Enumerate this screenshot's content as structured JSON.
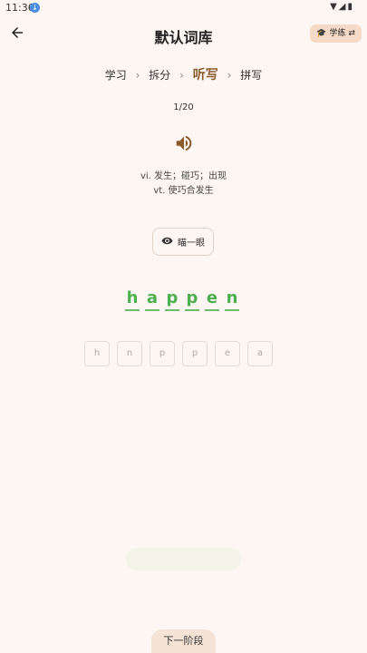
{
  "status": {
    "time": "11:36",
    "notification_badge": "◉",
    "icons": "▾◢▮"
  },
  "header": {
    "title": "默认词库",
    "mode_badge": "学练"
  },
  "steps": [
    {
      "label": "学习"
    },
    {
      "label": "拆分"
    },
    {
      "label": "听写",
      "active": true
    },
    {
      "label": "拼写"
    }
  ],
  "progress": "1/20",
  "definitions": [
    "vi. 发生；碰巧；出现",
    "vt. 使巧合发生"
  ],
  "peek_label": "瞄一眼",
  "answer_letters": [
    "h",
    "a",
    "p",
    "p",
    "e",
    "n"
  ],
  "letter_tiles": [
    "h",
    "n",
    "p",
    "p",
    "e",
    "a"
  ],
  "next_label": "下一阶段",
  "colors": {
    "accent": "#8a5a2b",
    "correct": "#4caf50",
    "background": "#fdf6f2",
    "badge": "#f6d9c6"
  }
}
